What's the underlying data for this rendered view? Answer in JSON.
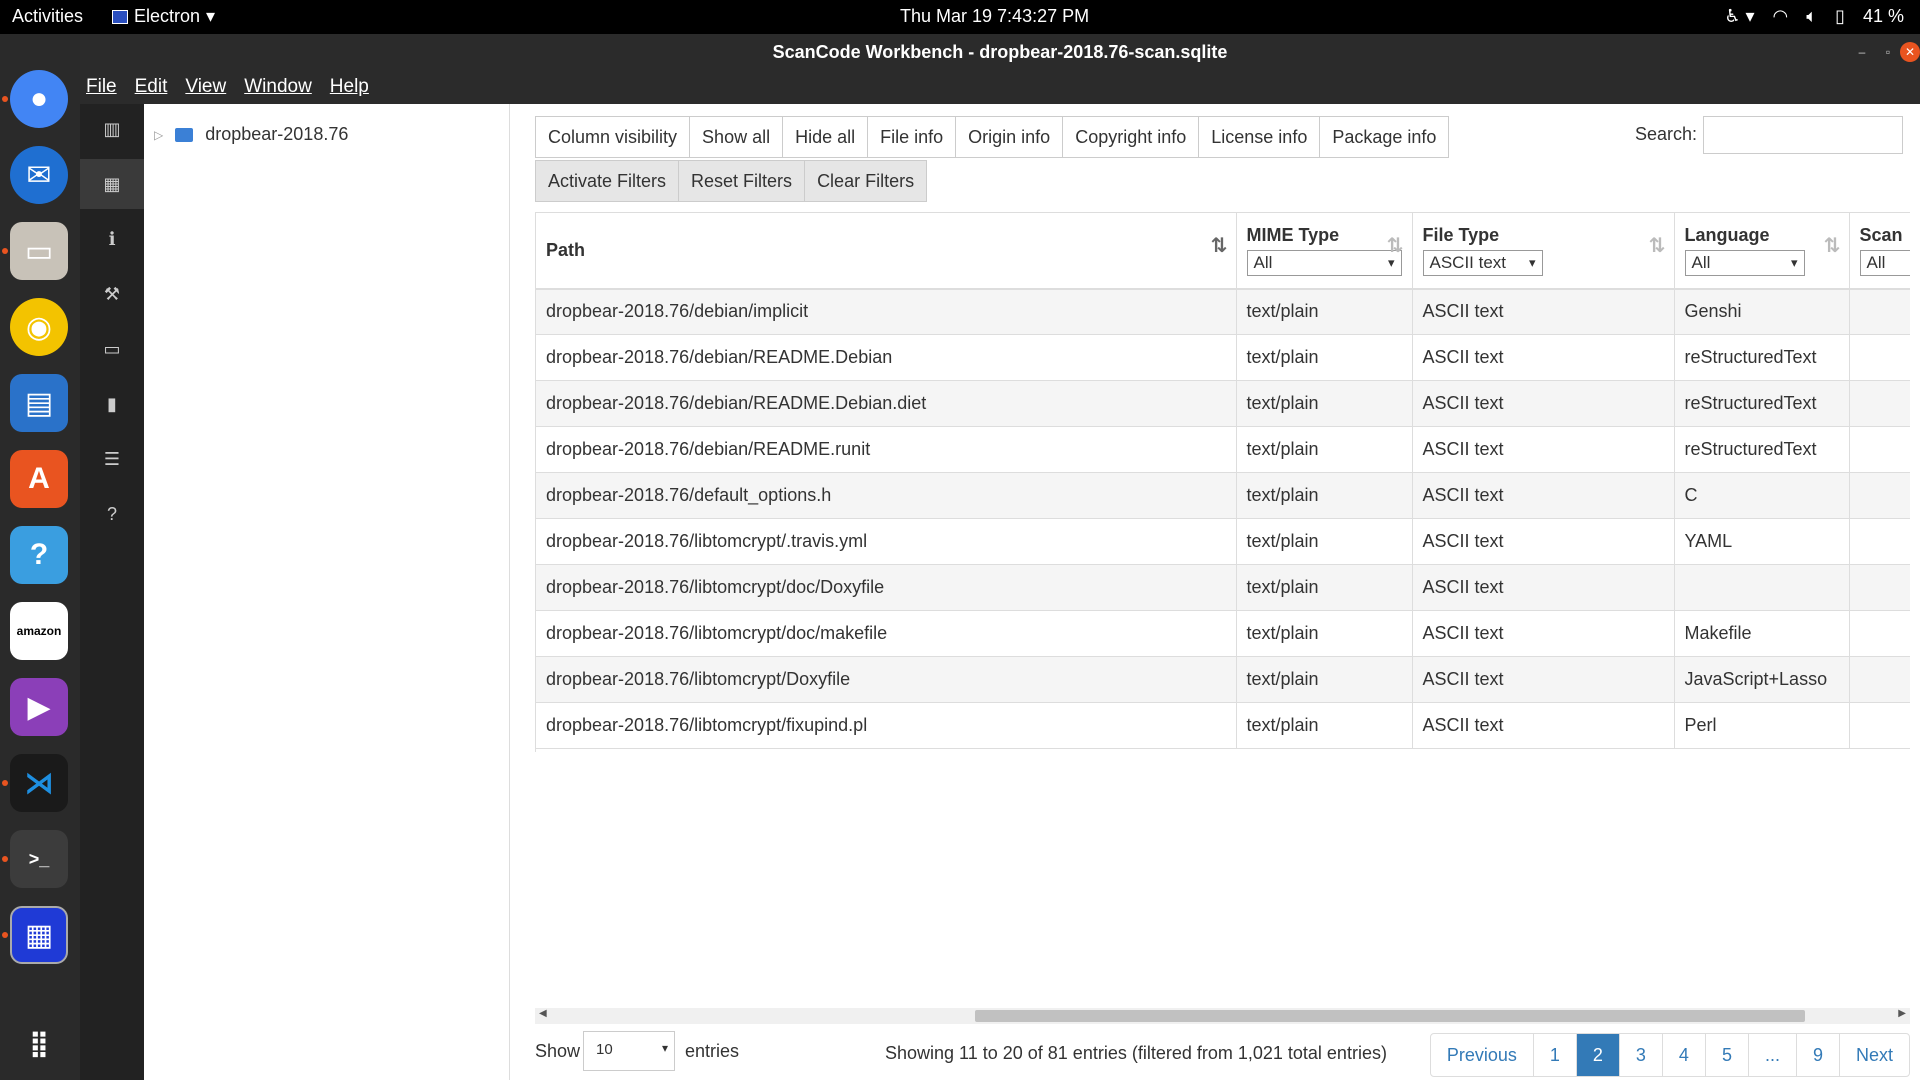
{
  "topbar": {
    "activities": "Activities",
    "app_name": "Electron",
    "datetime": "Thu Mar 19   7:43:27 PM",
    "battery": "41 %"
  },
  "window": {
    "title": "ScanCode Workbench - dropbear-2018.76-scan.sqlite",
    "menu": [
      "File",
      "Edit",
      "View",
      "Window",
      "Help"
    ]
  },
  "tree": {
    "root": "dropbear-2018.76"
  },
  "toolbar": {
    "buttons": [
      "Column visibility",
      "Show all",
      "Hide all",
      "File info",
      "Origin info",
      "Copyright info",
      "License info",
      "Package info"
    ],
    "filter_buttons": [
      "Activate Filters",
      "Reset Filters",
      "Clear Filters"
    ],
    "search_label": "Search:",
    "search_value": ""
  },
  "table": {
    "columns": [
      "Path",
      "MIME Type",
      "File Type",
      "Language",
      "Scan"
    ],
    "filters": [
      "All",
      "ASCII text",
      "All",
      "All"
    ],
    "rows": [
      [
        "dropbear-2018.76/debian/implicit",
        "text/plain",
        "ASCII text",
        "Genshi"
      ],
      [
        "dropbear-2018.76/debian/README.Debian",
        "text/plain",
        "ASCII text",
        "reStructuredText"
      ],
      [
        "dropbear-2018.76/debian/README.Debian.diet",
        "text/plain",
        "ASCII text",
        "reStructuredText"
      ],
      [
        "dropbear-2018.76/debian/README.runit",
        "text/plain",
        "ASCII text",
        "reStructuredText"
      ],
      [
        "dropbear-2018.76/default_options.h",
        "text/plain",
        "ASCII text",
        "C"
      ],
      [
        "dropbear-2018.76/libtomcrypt/.travis.yml",
        "text/plain",
        "ASCII text",
        "YAML"
      ],
      [
        "dropbear-2018.76/libtomcrypt/doc/Doxyfile",
        "text/plain",
        "ASCII text",
        ""
      ],
      [
        "dropbear-2018.76/libtomcrypt/doc/makefile",
        "text/plain",
        "ASCII text",
        "Makefile"
      ],
      [
        "dropbear-2018.76/libtomcrypt/Doxyfile",
        "text/plain",
        "ASCII text",
        "JavaScript+Lasso"
      ],
      [
        "dropbear-2018.76/libtomcrypt/fixupind.pl",
        "text/plain",
        "ASCII text",
        "Perl"
      ]
    ]
  },
  "footer": {
    "show_label": "Show",
    "page_length": "10",
    "entries_label": "entries",
    "info": "Showing 11 to 20 of 81 entries (filtered from 1,021 total entries)",
    "pages": [
      "Previous",
      "1",
      "2",
      "3",
      "4",
      "5",
      "...",
      "9",
      "Next"
    ],
    "active_page": "2"
  }
}
